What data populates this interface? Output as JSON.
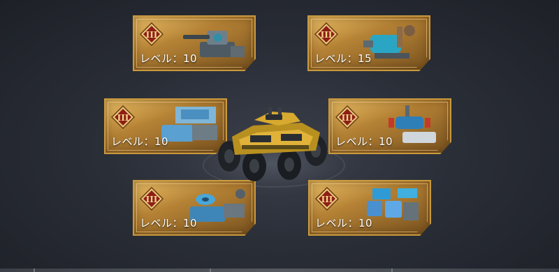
{
  "parts": [
    {
      "id": "turret",
      "tier": "III",
      "level_text": "レベル：10",
      "icon": "turret-icon"
    },
    {
      "id": "engine",
      "tier": "III",
      "level_text": "レベル：15",
      "icon": "engine-icon"
    },
    {
      "id": "armor",
      "tier": "III",
      "level_text": "レベル：10",
      "icon": "armor-plate-icon"
    },
    {
      "id": "crane",
      "tier": "III",
      "level_text": "レベル：10",
      "icon": "crane-icon"
    },
    {
      "id": "wheel",
      "tier": "III",
      "level_text": "レベル：10",
      "icon": "wheel-icon"
    },
    {
      "id": "electronics",
      "tier": "III",
      "level_text": "レベル：10",
      "icon": "electronics-icon"
    }
  ],
  "vehicle": {
    "icon": "armored-vehicle-icon"
  },
  "colors": {
    "card_gold": "#c99a3e",
    "badge_red": "#8e1e16",
    "background": "#2a2e37"
  }
}
